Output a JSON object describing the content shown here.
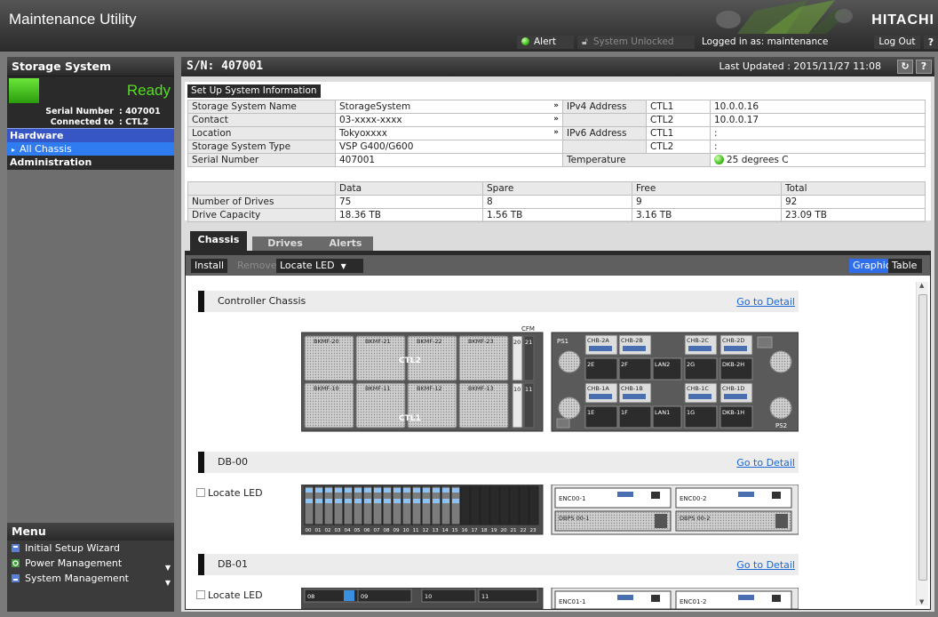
{
  "app": {
    "title": "Maintenance Utility",
    "brand": "HITACHI"
  },
  "topbar": {
    "alert_label": "Alert",
    "unlock_label": "System Unlocked",
    "logged_in_label": "Logged in as:",
    "user": "maintenance",
    "logout_label": "Log Out",
    "help_label": "?"
  },
  "sidebar": {
    "title": "Storage System",
    "status": "Ready",
    "serial_label": "Serial Number",
    "serial_value": ": 407001",
    "connected_label": "Connected to",
    "connected_value": ": CTL2",
    "nav": {
      "hardware": "Hardware",
      "all_chassis": "All Chassis",
      "administration": "Administration"
    }
  },
  "menu": {
    "title": "Menu",
    "items": [
      "Initial Setup Wizard",
      "Power Management",
      "System Management"
    ]
  },
  "main": {
    "sn": "S/N: 407001",
    "last_updated": "Last Updated : 2015/11/27 11:08",
    "refresh_icon": "refresh-icon",
    "help_label": "?"
  },
  "info": {
    "setup_button": "Set Up System Information",
    "rows": [
      {
        "label": "Storage System Name",
        "value": "StorageSystem"
      },
      {
        "label": "Contact",
        "value": "03-xxxx-xxxx"
      },
      {
        "label": "Location",
        "value": "Tokyoxxxx"
      },
      {
        "label": "Storage System Type",
        "value": "VSP G400/G600"
      },
      {
        "label": "Serial Number",
        "value": "407001"
      }
    ],
    "ipv4_label": "IPv4 Address",
    "ipv6_label": "IPv6 Address",
    "ctl1": "CTL1",
    "ctl2": "CTL2",
    "ipv4_ctl1": "10.0.0.16",
    "ipv4_ctl2": "10.0.0.17",
    "ipv6_ctl1": ":",
    "ipv6_ctl2": ":",
    "temperature_label": "Temperature",
    "temperature_value": "25 degrees C"
  },
  "drives": {
    "headers": [
      "Data",
      "Spare",
      "Free",
      "Total"
    ],
    "rows": [
      {
        "label": "Number of Drives",
        "values": [
          "75",
          "8",
          "9",
          "92"
        ]
      },
      {
        "label": "Drive Capacity",
        "values": [
          "18.36 TB",
          "1.56 TB",
          "3.16 TB",
          "23.09 TB"
        ]
      }
    ]
  },
  "tabs": [
    "Chassis",
    "Drives",
    "Alerts"
  ],
  "toolbar": {
    "install": "Install",
    "remove": "Remove",
    "locate_led": "Locate LED",
    "graphic": "Graphic",
    "table": "Table"
  },
  "chassis": {
    "go_to_detail": "Go to Detail",
    "locate_led": "Locate LED",
    "sections": [
      "Controller Chassis",
      "DB-00",
      "DB-01"
    ],
    "controller": {
      "cfm_label": "CFM",
      "ctl_labels": [
        "CTL2",
        "CTL1"
      ],
      "bkmf_top": [
        "BKMF-20",
        "BKMF-21",
        "BKMF-22",
        "BKMF-23"
      ],
      "bkmf_bottom": [
        "BKMF-10",
        "BKMF-11",
        "BKMF-12",
        "BKMF-13"
      ],
      "fans_top": [
        "20",
        "21"
      ],
      "fans_bottom": [
        "10",
        "11"
      ],
      "rear_top": [
        "PS1",
        "CHB-2A",
        "CHB-2B",
        "CHB-2C",
        "CHB-2D",
        "2E",
        "2F",
        "LAN2",
        "2G",
        "DKB-2H"
      ],
      "rear_bottom": [
        "CHB-1A",
        "CHB-1B",
        "CHB-1C",
        "CHB-1D",
        "1E",
        "1F",
        "LAN1",
        "1G",
        "DKB-1H",
        "PS2"
      ]
    },
    "db00": {
      "slots": [
        "00",
        "01",
        "02",
        "03",
        "04",
        "05",
        "06",
        "07",
        "08",
        "09",
        "10",
        "11",
        "12",
        "13",
        "14",
        "15",
        "16",
        "17",
        "18",
        "19",
        "20",
        "21",
        "22",
        "23"
      ],
      "enc": [
        "ENC00-1",
        "ENC00-2"
      ],
      "dbps": [
        "DBPS 00-1",
        "DBPS 00-2"
      ]
    },
    "db01": {
      "slots": [
        "08",
        "09",
        "10",
        "11"
      ],
      "enc": [
        "ENC01-1",
        "ENC01-2"
      ]
    }
  }
}
